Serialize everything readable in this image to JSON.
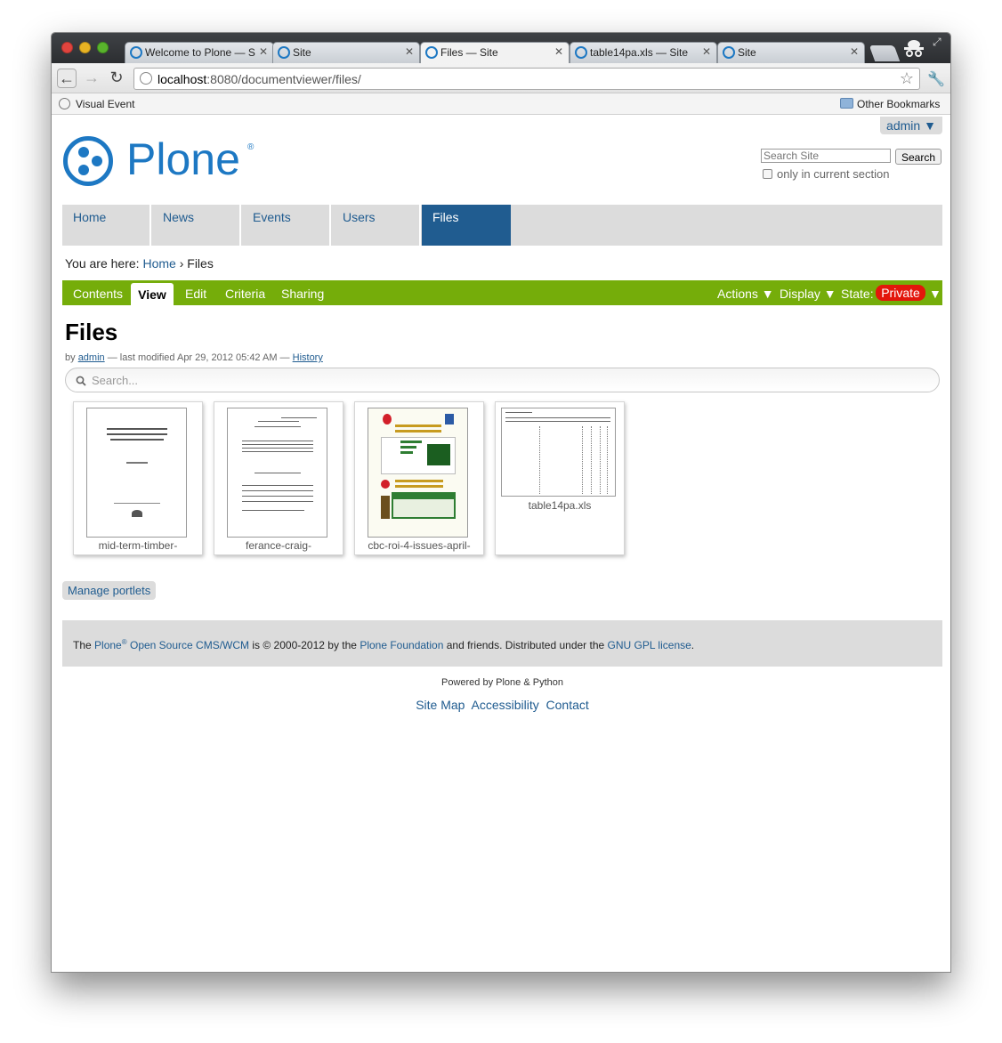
{
  "browser": {
    "tabs": [
      {
        "title": "Welcome to Plone — S",
        "active": false
      },
      {
        "title": "Site",
        "active": false
      },
      {
        "title": "Files — Site",
        "active": true
      },
      {
        "title": "table14pa.xls — Site",
        "active": false
      },
      {
        "title": "Site",
        "active": false
      }
    ],
    "url_host": "localhost",
    "url_rest": ":8080/documentviewer/files/",
    "bookmark_visual_event": "Visual Event",
    "bookmark_other": "Other Bookmarks"
  },
  "site": {
    "user_menu": "admin ▼",
    "logo_text": "Plone",
    "logo_mark": "®",
    "search_placeholder": "Search Site",
    "search_button": "Search",
    "search_option": "only in current section",
    "nav": [
      "Home",
      "News",
      "Events",
      "Users",
      "Files"
    ],
    "nav_active": "Files",
    "breadcrumb_label": "You are here:",
    "breadcrumb_home": "Home",
    "breadcrumb_sep": "›",
    "breadcrumb_current": "Files"
  },
  "editbar": {
    "contents": "Contents",
    "view": "View",
    "edit": "Edit",
    "criteria": "Criteria",
    "sharing": "Sharing",
    "actions": "Actions ▼",
    "display": "Display ▼",
    "state_label": "State:",
    "state_value": "Private",
    "state_arrow": "▼"
  },
  "content": {
    "title": "Files",
    "byline_by": "by",
    "byline_author": "admin",
    "byline_modified": "— last modified Apr 29, 2012 05:42 AM —",
    "byline_history": "History",
    "search_placeholder": "Search...",
    "files": [
      {
        "name": "mid-term-timber-"
      },
      {
        "name": "ferance-craig-"
      },
      {
        "name": "cbc-roi-4-issues-april-"
      },
      {
        "name": "table14pa.xls"
      }
    ],
    "manage_portlets": "Manage portlets"
  },
  "footer": {
    "text_the": "The",
    "plone": "Plone",
    "reg": "®",
    "cms": "Open Source CMS/WCM",
    "text_mid": "is © 2000-2012 by the",
    "foundation": "Plone Foundation",
    "text_end": "and friends. Distributed under the",
    "license": "GNU GPL license",
    "period": ".",
    "powered": "Powered by Plone & Python",
    "links": [
      "Site Map",
      "Accessibility",
      "Contact"
    ]
  },
  "colors": {
    "plone_blue": "#1d78c3",
    "nav_active": "#205c90",
    "editbar_green": "#75ad0a",
    "private_red": "#e3160b"
  }
}
